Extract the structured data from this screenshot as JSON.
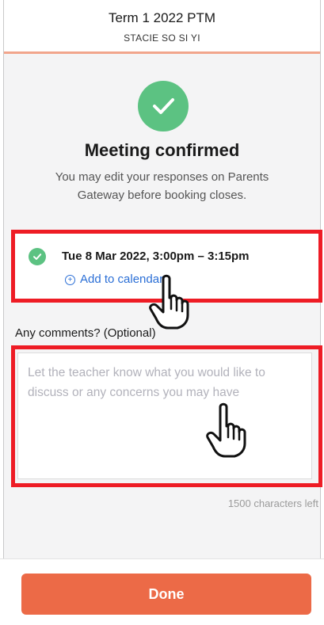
{
  "header": {
    "title": "Term 1 2022 PTM",
    "subtitle": "STACIE SO SI YI"
  },
  "confirmation": {
    "title": "Meeting confirmed",
    "message": "You may edit your responses on Parents Gateway before booking closes."
  },
  "slot": {
    "time": "Tue 8 Mar 2022, 3:00pm – 3:15pm",
    "add_calendar_label": "Add to calendar"
  },
  "comments": {
    "label": "Any comments? (Optional)",
    "placeholder": "Let the teacher know what you would like to discuss or any concerns you may have",
    "value": "",
    "chars_left": "1500 characters left"
  },
  "done_label": "Done",
  "colors": {
    "accent": "#ec6a47",
    "success": "#5cc282",
    "link": "#2b6fd6",
    "highlight": "#ee1c25"
  },
  "icons": [
    "check-icon",
    "add-circle-icon",
    "pointing-hand-icon"
  ]
}
